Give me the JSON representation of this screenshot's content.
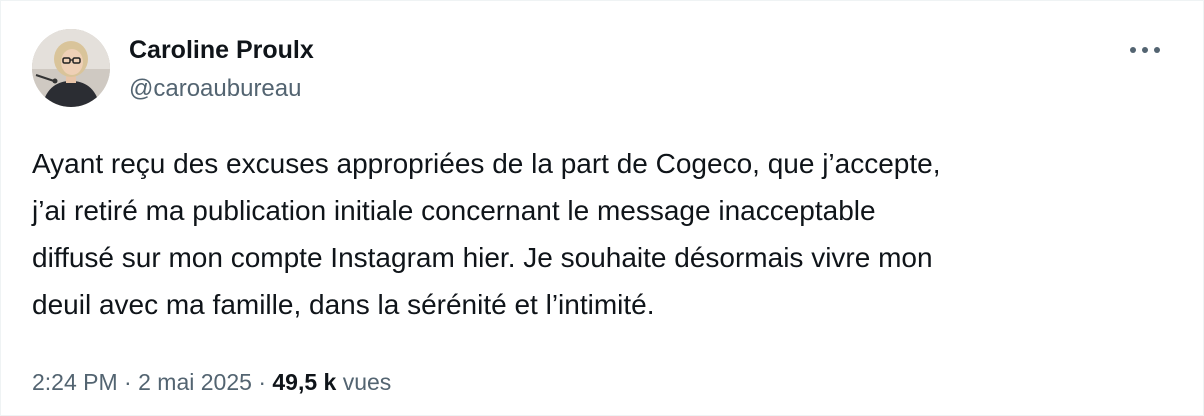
{
  "tweet": {
    "author": {
      "name": "Caroline Proulx",
      "handle": "@caroaubureau",
      "avatar_icon": "profile-photo"
    },
    "more_icon": "more-horizontal-icon",
    "text": "Ayant reçu des excuses appropriées de la part de Cogeco, que j’accepte,\nj’ai retiré ma publication initiale concernant le message inacceptable\ndiffusé sur mon compte Instagram hier. Je souhaite désormais vivre mon\ndeuil avec ma famille, dans la sérénité et l’intimité.",
    "time": "2:24 PM",
    "separator": "·",
    "date": "2 mai 2025",
    "views_count": "49,5 k",
    "views_label": "vues"
  },
  "colors": {
    "text_primary": "#0f1419",
    "text_secondary": "#536471",
    "border": "#eff3f4"
  }
}
